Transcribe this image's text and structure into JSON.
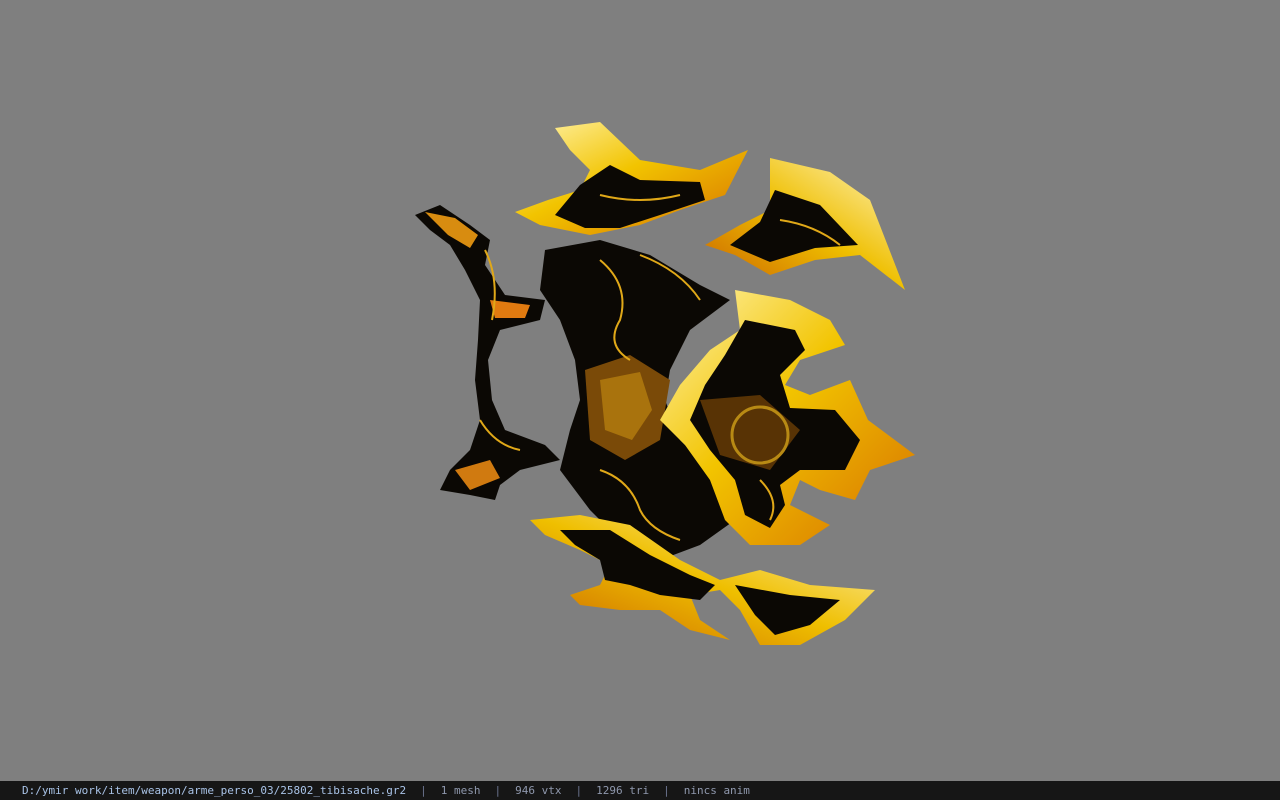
{
  "viewport": {
    "background": "#7f7f7f",
    "model_colors": {
      "gold": "#e6b800",
      "gold_light": "#fff2a0",
      "orange": "#d86a00",
      "dark": "#0b0804"
    }
  },
  "status_bar": {
    "file_path": "D:/ymir work/item/weapon/arme_perso_03/25802_tibisache.gr2",
    "separator": "|",
    "mesh_count": "1 mesh",
    "vertex_count": "946 vtx",
    "triangle_count": "1296 tri",
    "animation": "nincs anim"
  }
}
